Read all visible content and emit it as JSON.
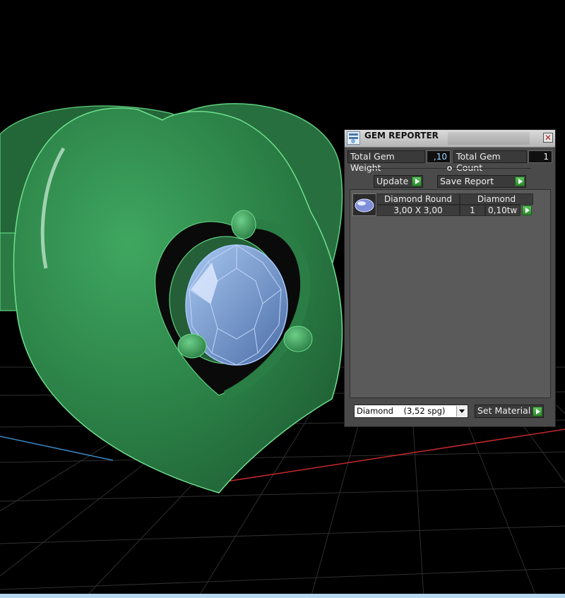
{
  "panel": {
    "title": "GEM REPORTER",
    "close_glyph": "✕",
    "total_weight_label": "Total Gem Weight",
    "total_weight_value": ",10",
    "total_count_label": "Total Gem Count",
    "total_count_value": "1",
    "update_label": "Update",
    "save_report_label": "Save Report",
    "report": {
      "columns": [
        "Diamond Round",
        "Diamond"
      ],
      "rows": [
        {
          "size": "3,00 X 3,00",
          "count": "1",
          "weight": "0,10tw"
        }
      ]
    },
    "material_select_value": "Diamond    (3,52 spg)",
    "set_material_label": "Set Material"
  },
  "colors": {
    "model_green": "#2e8a4a",
    "gem_blue": "#7fa6e0",
    "panel_bg": "#4a4a4a",
    "accent_play": "#3aa63a"
  },
  "icons": {
    "title": "gem-reporter-icon",
    "close": "close-icon",
    "action": "play-arrow-icon",
    "gem": "round-diamond-icon"
  }
}
